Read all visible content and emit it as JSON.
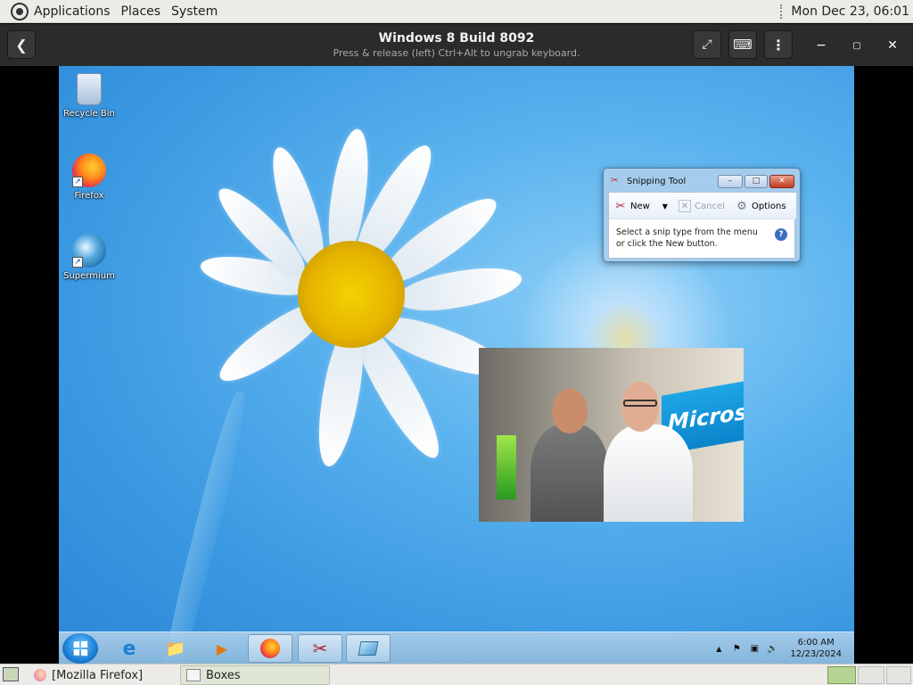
{
  "top_panel": {
    "menus": [
      "Applications",
      "Places",
      "System"
    ],
    "clock": "Mon Dec 23, 06:01"
  },
  "boxes_header": {
    "title": "Windows 8 Build 8092",
    "subtitle": "Press & release (left) Ctrl+Alt to ungrab keyboard."
  },
  "desktop": {
    "icons": [
      {
        "label": "Recycle Bin",
        "icon": "recycle-bin-icon"
      },
      {
        "label": "Firefox",
        "icon": "firefox-icon"
      },
      {
        "label": "Supermium",
        "icon": "supermium-icon"
      }
    ]
  },
  "snipping_tool": {
    "title": "Snipping Tool",
    "new_label": "New",
    "cancel_label": "Cancel",
    "options_label": "Options",
    "message": "Select a snip type from the menu or click the New button."
  },
  "video": {
    "brand_text": "Micros"
  },
  "taskbar": {
    "time": "6:00 AM",
    "date": "12/23/2024"
  },
  "bottom_panel": {
    "tasks": [
      "[Mozilla Firefox]",
      "Boxes"
    ]
  }
}
